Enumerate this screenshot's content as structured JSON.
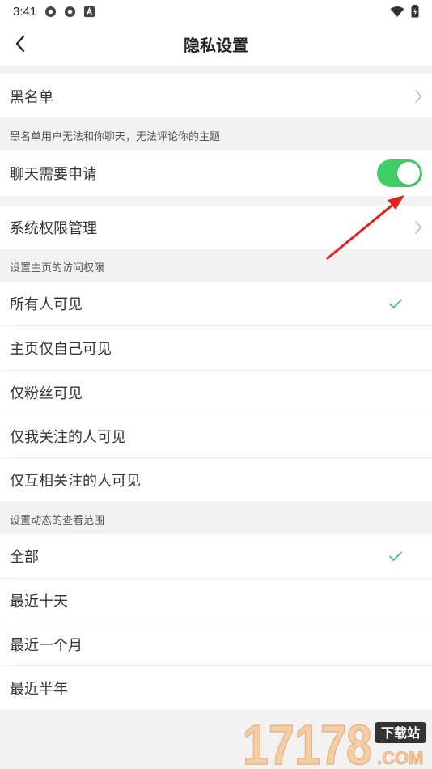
{
  "status_bar": {
    "time": "3:41"
  },
  "header": {
    "title": "隐私设置"
  },
  "blacklist": {
    "label": "黑名单"
  },
  "blacklist_note": "黑名单用户无法和你聊天，无法评论你的主题",
  "chat_request": {
    "label": "聊天需要申请",
    "enabled": true
  },
  "system_permissions": {
    "label": "系统权限管理"
  },
  "homepage_section": {
    "label": "设置主页的访问权限",
    "options": [
      "所有人可见",
      "主页仅自己可见",
      "仅粉丝可见",
      "仅我关注的人可见",
      "仅互相关注的人可见"
    ],
    "selected": "所有人可见"
  },
  "moments_section": {
    "label": "设置动态的查看范围",
    "options": [
      "全部",
      "最近十天",
      "最近一个月",
      "最近半年"
    ],
    "selected": "全部"
  },
  "watermark": {
    "digits": "17178",
    "badge": "下载站",
    "domain": ".COM"
  },
  "colors": {
    "accent": "#3fcf66",
    "arrow": "#e02020",
    "background": "#f2f2f2"
  }
}
